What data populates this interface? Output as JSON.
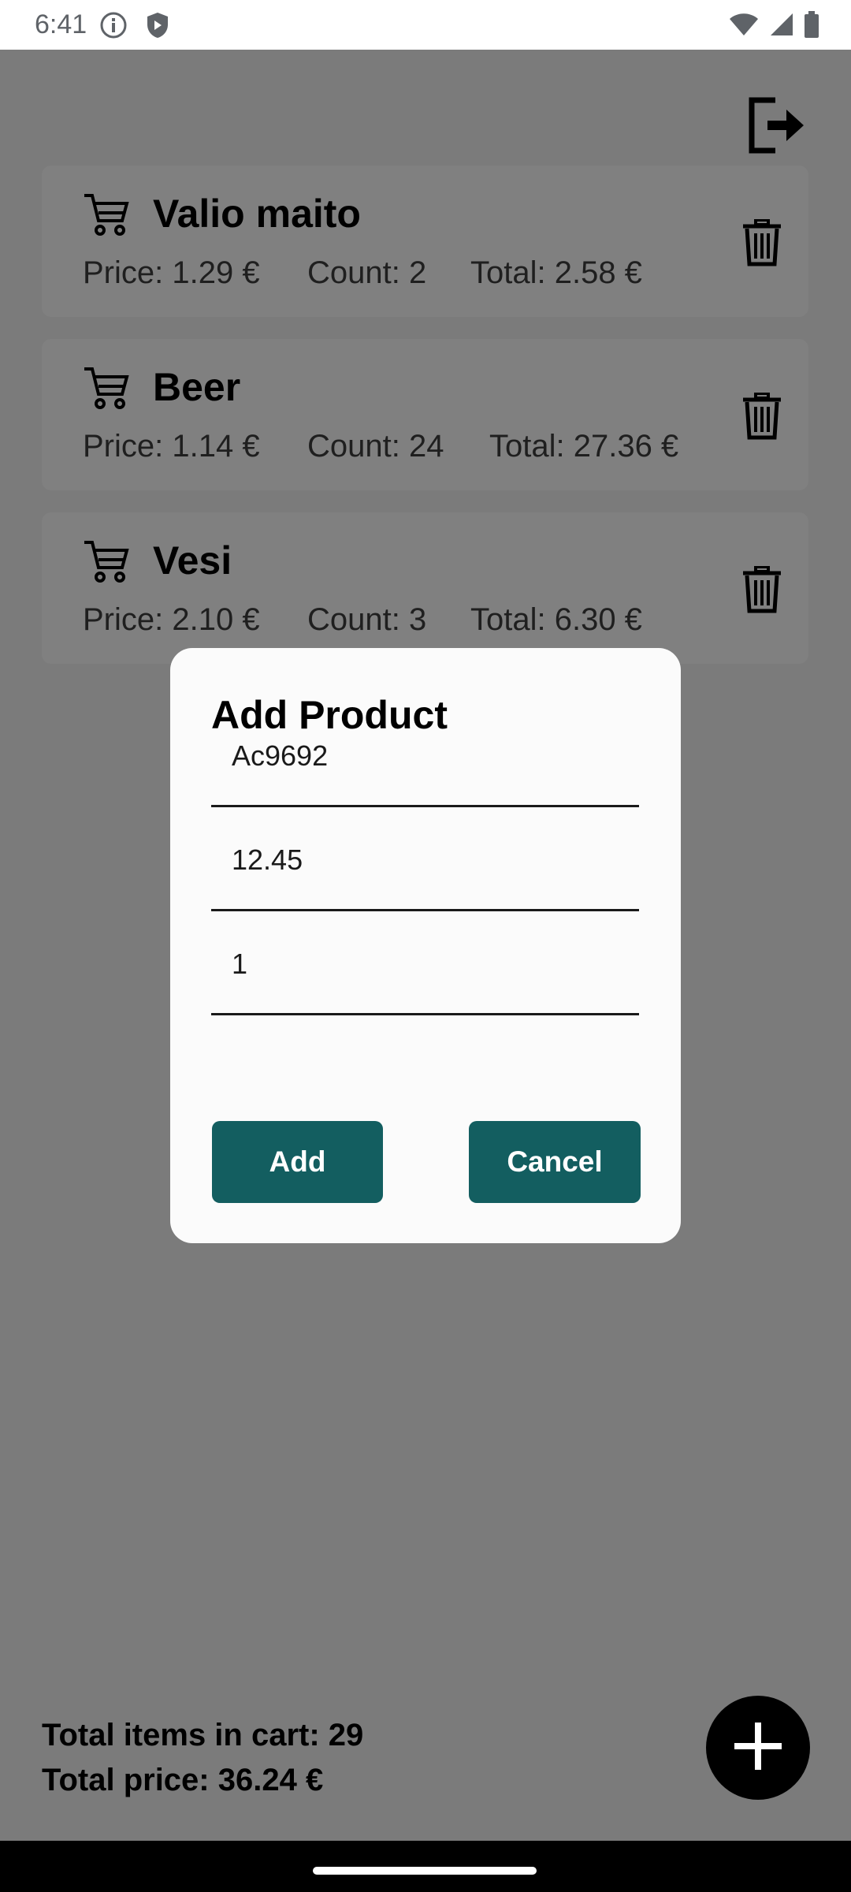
{
  "status_bar": {
    "time": "6:41",
    "icons": [
      "info-icon",
      "shield-icon",
      "wifi-icon",
      "signal-icon",
      "battery-icon"
    ]
  },
  "toolbar": {
    "logout_icon": "logout-icon"
  },
  "cart": {
    "items": [
      {
        "name": "Valio maito",
        "price": "Price: 1.29 €",
        "count": "Count: 2",
        "total": "Total: 2.58 €"
      },
      {
        "name": "Beer",
        "price": "Price: 1.14 €",
        "count": "Count: 24",
        "total": "Total: 27.36 €"
      },
      {
        "name": "Vesi",
        "price": "Price: 2.10 €",
        "count": "Count: 3",
        "total": "Total: 6.30 €"
      }
    ]
  },
  "summary": {
    "total_items": "Total items in cart: 29",
    "total_price": "Total price: 36.24 €"
  },
  "dialog": {
    "title": "Add Product",
    "fields": [
      {
        "value": "Ac9692"
      },
      {
        "value": "12.45"
      },
      {
        "value": "1"
      }
    ],
    "add_label": "Add",
    "cancel_label": "Cancel"
  },
  "colors": {
    "accent": "#135e60",
    "overlay_background": "#7b7b7b",
    "card_background": "#808080"
  }
}
